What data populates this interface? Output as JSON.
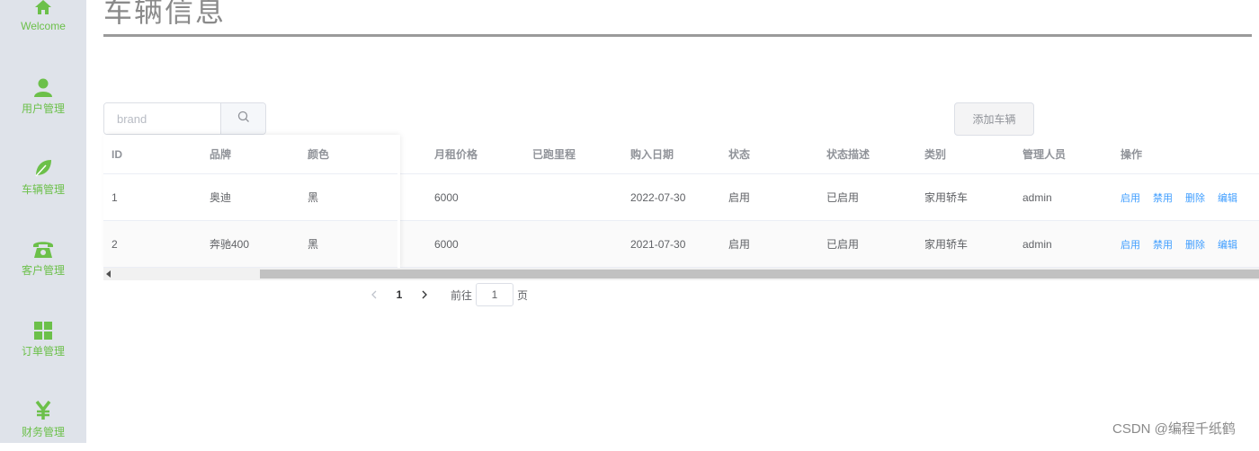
{
  "sidebar": {
    "items": [
      {
        "label": "Welcome",
        "icon": "home-icon"
      },
      {
        "label": "用户管理",
        "icon": "user-icon"
      },
      {
        "label": "车辆管理",
        "icon": "leaf-icon"
      },
      {
        "label": "客户管理",
        "icon": "phone-icon"
      },
      {
        "label": "订单管理",
        "icon": "grid-icon"
      },
      {
        "label": "财务管理",
        "icon": "yen-icon"
      }
    ],
    "accent_color": "#6cc04a"
  },
  "page": {
    "title": "车辆信息"
  },
  "search": {
    "placeholder": "brand",
    "value": ""
  },
  "toolbar": {
    "add_label": "添加车辆"
  },
  "table": {
    "columns": [
      "ID",
      "品牌",
      "颜色",
      "月租价格",
      "已跑里程",
      "购入日期",
      "状态",
      "状态描述",
      "类别",
      "管理人员",
      "操作"
    ],
    "rows": [
      {
        "id": "1",
        "brand": "奥迪",
        "color": "黑",
        "price": "6000",
        "mileage": "",
        "date": "2022-07-30",
        "status": "启用",
        "status_desc": "已启用",
        "category": "家用轿车",
        "manager": "admin"
      },
      {
        "id": "2",
        "brand": "奔驰400",
        "color": "黑",
        "price": "6000",
        "mileage": "",
        "date": "2021-07-30",
        "status": "启用",
        "status_desc": "已启用",
        "category": "家用轿车",
        "manager": "admin"
      }
    ],
    "actions": [
      "启用",
      "禁用",
      "删除",
      "编辑"
    ],
    "action_color": "#409eff"
  },
  "pagination": {
    "current_page": "1",
    "goto_prefix": "前往",
    "goto_value": "1",
    "goto_suffix": "页"
  },
  "watermark": "CSDN @编程千纸鹤"
}
